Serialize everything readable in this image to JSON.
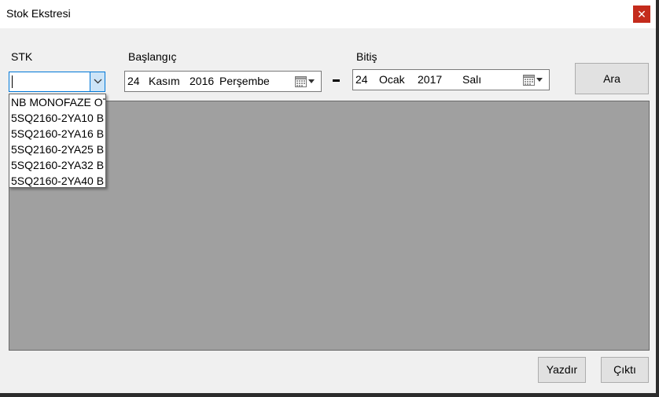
{
  "window": {
    "title": "Stok Ekstresi",
    "close_glyph": "✕"
  },
  "form": {
    "stk_label": "STK",
    "stk_value": "",
    "stk_options": [
      "NB MONOFAZE OTOMATİK",
      "5SQ2160-2YA10 B",
      "5SQ2160-2YA16 B",
      "5SQ2160-2YA25 B",
      "5SQ2160-2YA32 B",
      "5SQ2160-2YA40 B"
    ],
    "start": {
      "label": "Başlangıç",
      "day": "24",
      "month": "Kasım",
      "year": "2016",
      "weekday": "Perşembe"
    },
    "end": {
      "label": "Bitiş",
      "day": "24",
      "month": "Ocak",
      "year": "2017",
      "weekday": "Salı"
    },
    "search_button": "Ara"
  },
  "footer": {
    "print_button": "Yazdır",
    "exit_button": "Çıktı"
  },
  "colors": {
    "accent": "#0078d7",
    "close": "#c42b1c",
    "grid_bg": "#a0a0a0"
  },
  "icons": {
    "dropdown": "chevron-down-icon",
    "calendar": "calendar-icon",
    "close": "close-icon"
  }
}
